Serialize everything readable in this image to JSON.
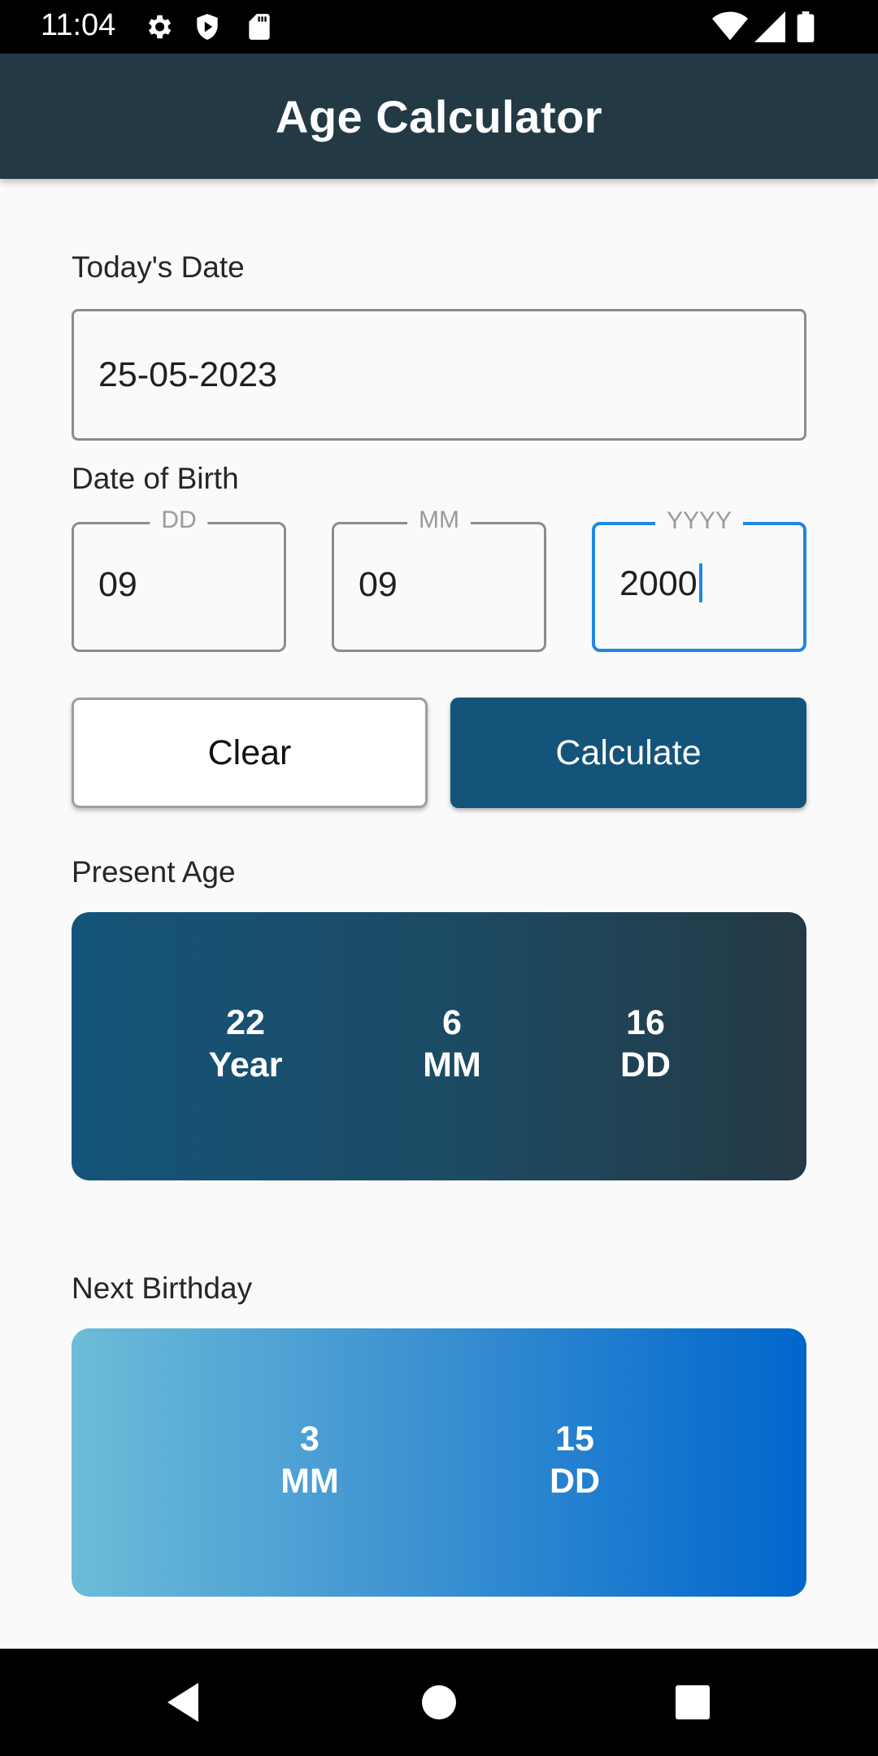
{
  "status_bar": {
    "time": "11:04",
    "left_icons": [
      "gear-icon",
      "shield-play-icon",
      "sd-card-icon"
    ],
    "right_icons": [
      "wifi-icon",
      "signal-icon",
      "battery-icon"
    ]
  },
  "app_bar": {
    "title": "Age Calculator"
  },
  "today": {
    "label": "Today's Date",
    "value": "25-05-2023"
  },
  "dob": {
    "label": "Date of Birth",
    "day": {
      "hint": "DD",
      "value": "09"
    },
    "month": {
      "hint": "MM",
      "value": "09"
    },
    "year": {
      "hint": "YYYY",
      "value": "2000"
    }
  },
  "buttons": {
    "clear_label": "Clear",
    "calculate_label": "Calculate"
  },
  "present_age": {
    "label": "Present Age",
    "years": {
      "value": "22",
      "unit": "Year"
    },
    "months": {
      "value": "6",
      "unit": "MM"
    },
    "days": {
      "value": "16",
      "unit": "DD"
    }
  },
  "next_birthday": {
    "label": "Next Birthday",
    "months": {
      "value": "3",
      "unit": "MM"
    },
    "days": {
      "value": "15",
      "unit": "DD"
    }
  },
  "nav_bar": {
    "buttons": [
      "back-icon",
      "home-icon",
      "recents-icon"
    ]
  },
  "colors": {
    "app_bar": "#233a45",
    "accent_focus": "#1e88e5",
    "calculate_button": "#15547a",
    "age_card_start": "#14547a",
    "age_card_end": "#243944",
    "next_card_start": "#6cbcd8",
    "next_card_end": "#0066cc"
  }
}
